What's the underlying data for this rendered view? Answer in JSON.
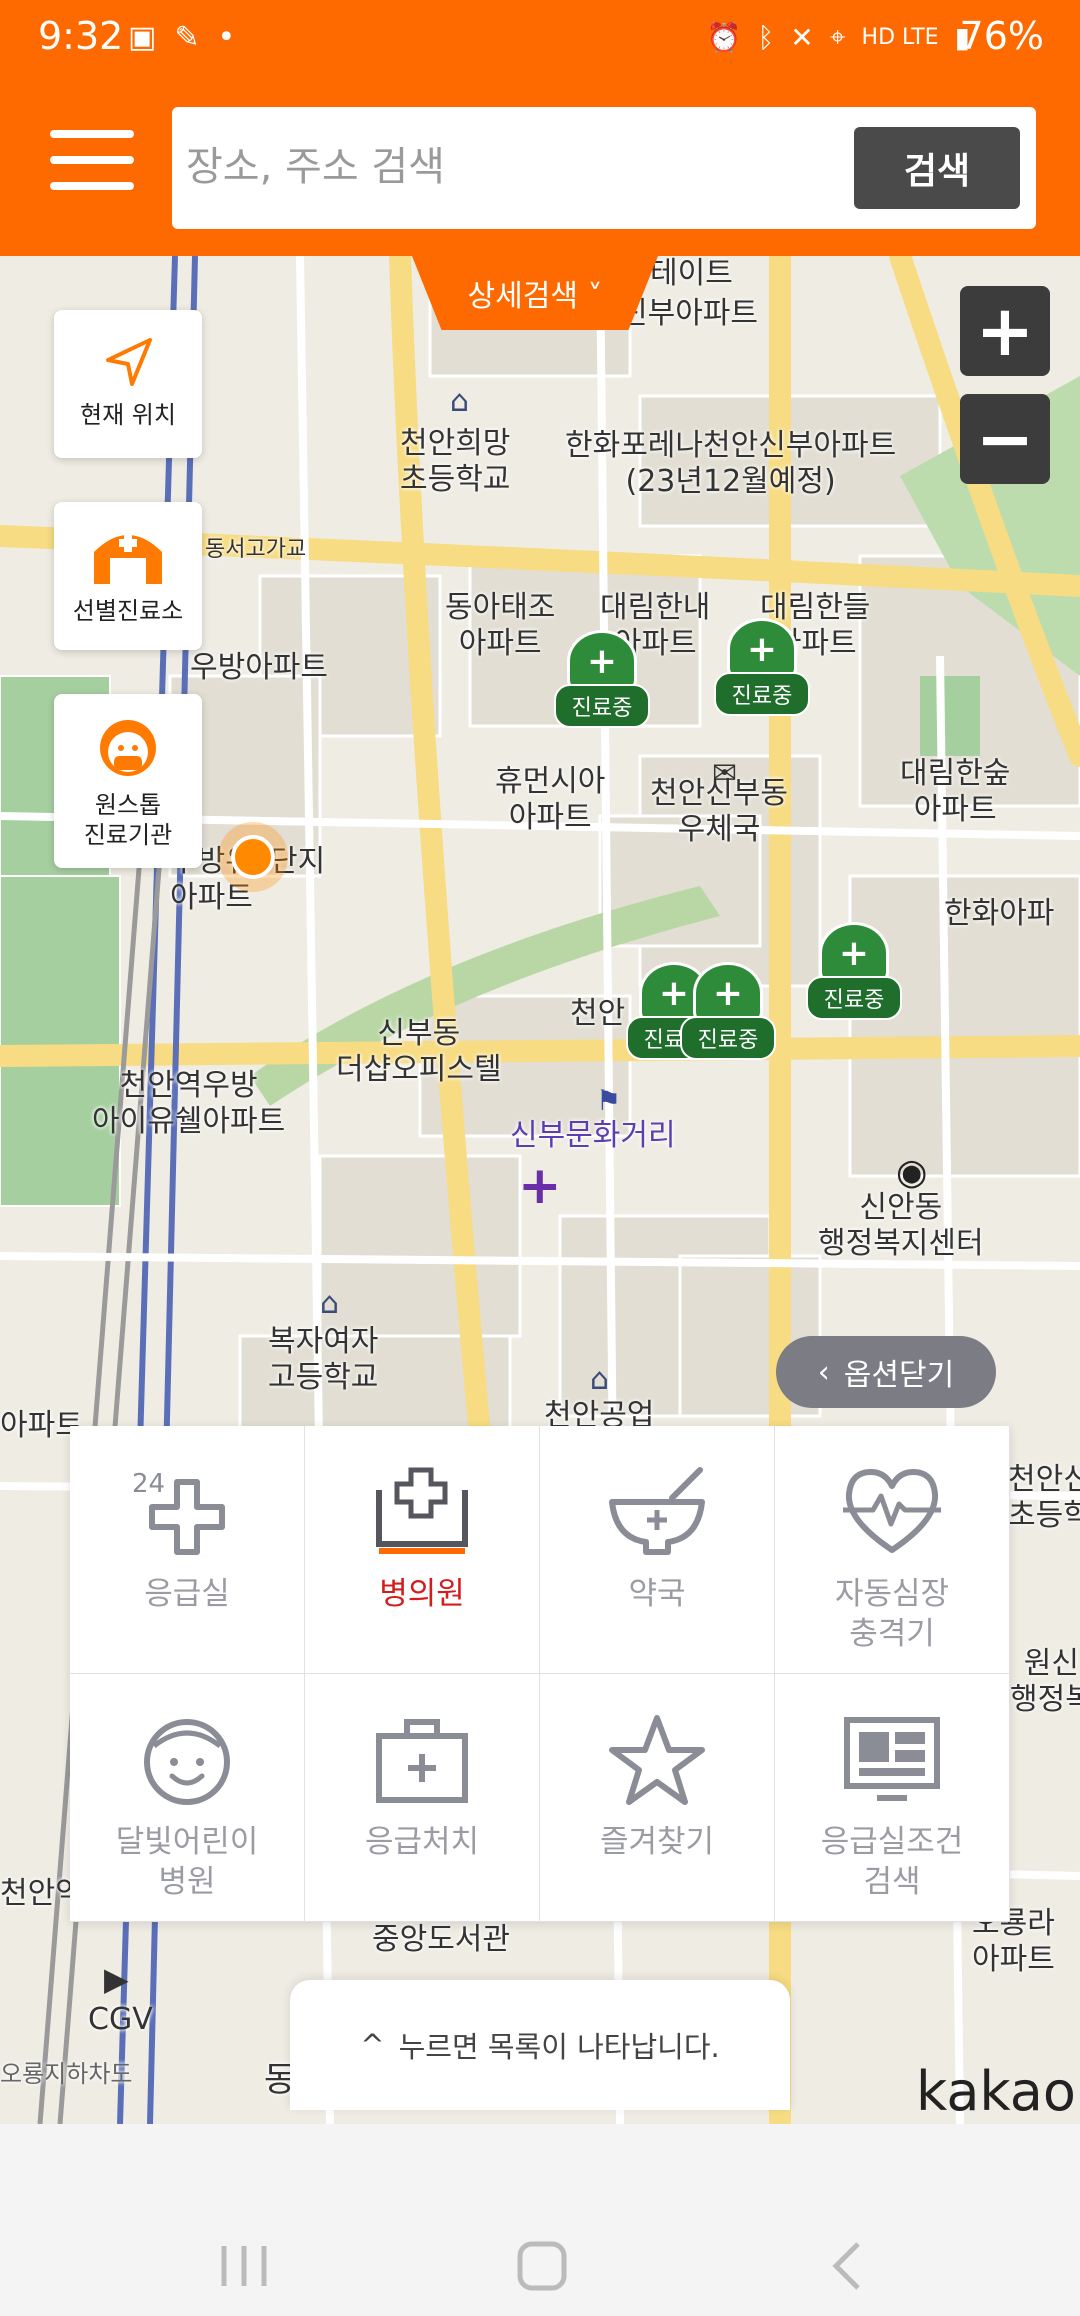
{
  "status_bar": {
    "time": "9:32",
    "network": "HD LTE",
    "battery": "76%"
  },
  "header": {
    "search_placeholder": "장소, 주소 검색",
    "search_button": "검색"
  },
  "detail_search": "상세검색 ˅",
  "zoom": {
    "in": "+",
    "out": "−"
  },
  "side_buttons": [
    {
      "label": "현재 위치",
      "icon": "navigation-arrow-icon"
    },
    {
      "label": "선별진료소",
      "icon": "clinic-tent-icon"
    },
    {
      "label": "원스톱\n진료기관",
      "icon": "masked-doctor-icon"
    }
  ],
  "map_labels": [
    "테이트",
    "신부아파트",
    "천안희망\n초등학교",
    "한화포레나천안신부아파트\n(23년12월예정)",
    "동서고가교",
    "동아태조\n아파트",
    "대림한내\n아파트",
    "대림한들\n아파트",
    "우방아파트",
    "휴먼시아\n아파트",
    "천안신부동\n우체국",
    "대림한숲\n아파트",
    "우방유\n아파트",
    "단지",
    "한화아파",
    "천안",
    "신부동\n더샵오피스텔",
    "천안역우방\n아이유쉘아파트",
    "신부문화거리",
    "신안동\n행정복지센터",
    "복자여자\n고등학교",
    "천안공업",
    "아파트",
    "천안신\n초등학",
    "원신\n행정복",
    "중앙도서관",
    "CGV",
    "오룡지하차도",
    "오룡라\n아파트",
    "천안역",
    "동남구청"
  ],
  "pin_tag": "진료중",
  "options_close": "옵션닫기",
  "categories": [
    {
      "label": "응급실",
      "icon": "emergency-24-icon"
    },
    {
      "label": "병의원",
      "icon": "hospital-icon"
    },
    {
      "label": "약국",
      "icon": "pharmacy-bowl-icon"
    },
    {
      "label": "자동심장\n충격기",
      "icon": "heart-pulse-icon"
    },
    {
      "label": "달빛어린이\n병원",
      "icon": "child-face-icon"
    },
    {
      "label": "응급처치",
      "icon": "first-aid-kit-icon"
    },
    {
      "label": "즐겨찾기",
      "icon": "star-icon"
    },
    {
      "label": "응급실조건\n검색",
      "icon": "monitor-icon"
    }
  ],
  "active_category": "병의원",
  "list_hint": "누르면 목록이 나타납니다.",
  "brand": "kakao",
  "colors": {
    "accent": "#ff6a00",
    "active": "#d51c1c",
    "pin": "#2e8b3a"
  }
}
